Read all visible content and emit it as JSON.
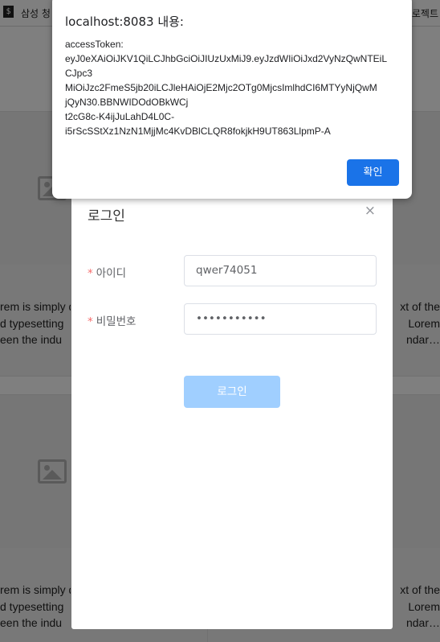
{
  "browser": {
    "tab_title": "삼성 청",
    "right_text": "로젝트"
  },
  "page": {
    "card_snippet_left": [
      "rem is simply d",
      "d typesetting",
      "een the indu"
    ],
    "card_snippet_right": [
      "xt of the",
      "Lorem",
      "ndar…"
    ]
  },
  "login_modal": {
    "title": "로그인",
    "close_symbol": "×",
    "required_mark": "*",
    "id_label": "아이디",
    "id_value": "qwer74051",
    "password_label": "비밀번호",
    "password_masked": "•••••••••••",
    "login_button": "로그인"
  },
  "alert": {
    "title": "localhost:8083 내용:",
    "lines": [
      "accessToken:",
      "eyJ0eXAiOiJKV1QiLCJhbGciOiJIUzUxMiJ9.eyJzdWIiOiJxd2VyNzQwNTEiL",
      "CJpc3",
      "MiOiJzc2FmeS5jb20iLCJleHAiOjE2Mjc2OTg0MjcsImlhdCI6MTYyNjQwM",
      "jQyN30.BBNWIDOdOBkWCj",
      "t2cG8c-K4ijJuLahD4L0C-",
      "i5rScSStXz1NzN1MjjMc4KvDBlCLQR8fokjkH9UT863LlpmP-A"
    ],
    "ok_button": "확인"
  }
}
